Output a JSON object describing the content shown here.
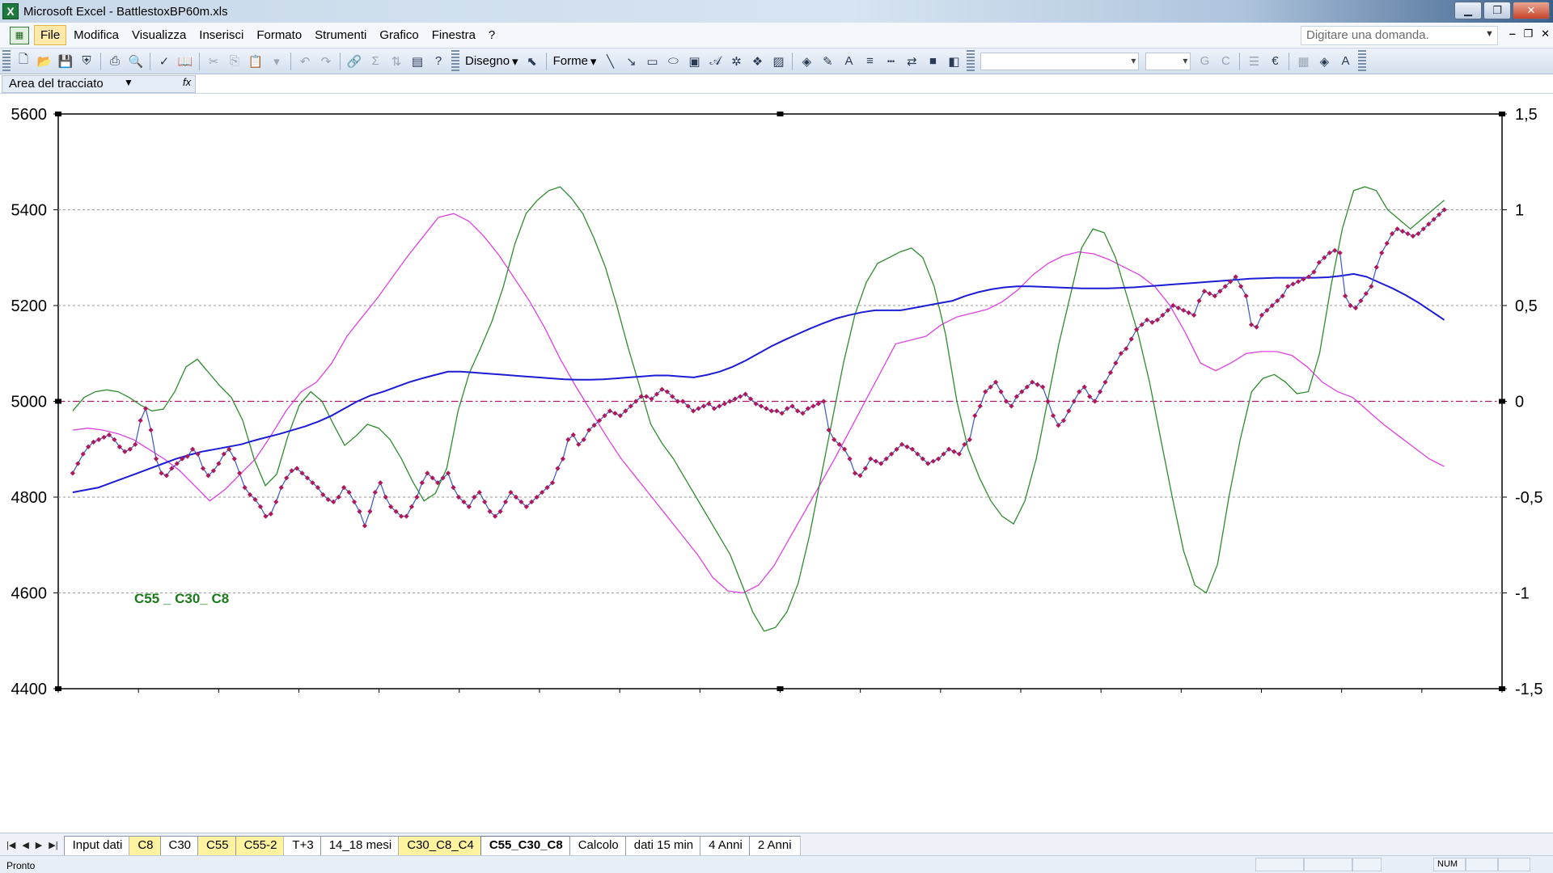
{
  "window": {
    "title": "Microsoft Excel - BattlestoxBP60m.xls",
    "min_glyph": "▁",
    "max_glyph": "❐",
    "close_glyph": "✕"
  },
  "menu": {
    "items": [
      "File",
      "Modifica",
      "Visualizza",
      "Inserisci",
      "Formato",
      "Strumenti",
      "Grafico",
      "Finestra",
      "?"
    ],
    "ask_placeholder": "Digitare una domanda.",
    "doc_buttons": [
      "‒",
      "❐",
      "✕"
    ]
  },
  "toolbar": {
    "draw_label": "Disegno",
    "shapes_label": "Forme",
    "bold": "G",
    "italic": "C",
    "euro": "€"
  },
  "objectbar": {
    "selected_object": "Area del tracciato",
    "fx": "fx"
  },
  "sheet_tabs": [
    {
      "label": "Input dati",
      "color": "white"
    },
    {
      "label": "C8",
      "color": "yellow"
    },
    {
      "label": "C30",
      "color": "white"
    },
    {
      "label": "C55",
      "color": "yellow"
    },
    {
      "label": "C55-2",
      "color": "yellow"
    },
    {
      "label": "T+3",
      "color": "white"
    },
    {
      "label": "14_18 mesi",
      "color": "white"
    },
    {
      "label": "C30_C8_C4",
      "color": "yellow"
    },
    {
      "label": "C55_C30_C8",
      "color": "active"
    },
    {
      "label": "Calcolo",
      "color": "white"
    },
    {
      "label": "dati 15 min",
      "color": "white"
    },
    {
      "label": "4 Anni",
      "color": "white"
    },
    {
      "label": "2 Anni",
      "color": "white"
    }
  ],
  "status": {
    "ready": "Pronto",
    "num": "NUM"
  },
  "chart_data": {
    "type": "line",
    "title": "",
    "annotation": "C55 _ C30_ C8",
    "annotation_color": "#1a7a1a",
    "y_left": {
      "min": 4400,
      "max": 5600,
      "ticks": [
        4400,
        4600,
        4800,
        5000,
        5200,
        5400,
        5600
      ]
    },
    "y_right": {
      "min": -1.5,
      "max": 1.5,
      "ticks": [
        "-1,5",
        "-1",
        "-0,5",
        "0",
        "0,5",
        "1",
        "1,5"
      ]
    },
    "x_points": 240,
    "grid": "horizontal dashed",
    "zero_line_color": "#b0186a",
    "colors": {
      "price_line": "#3a57c6",
      "price_marker": "#b0185a",
      "ma": "#1c1cd6",
      "green": "#2e8b2e",
      "magenta": "#e040e0"
    },
    "series": [
      {
        "axis": "left",
        "role": "price",
        "values": [
          4850,
          4870,
          4890,
          4905,
          4915,
          4920,
          4925,
          4930,
          4920,
          4905,
          4895,
          4900,
          4910,
          4960,
          4985,
          4940,
          4880,
          4850,
          4845,
          4860,
          4870,
          4880,
          4885,
          4900,
          4890,
          4860,
          4845,
          4855,
          4870,
          4890,
          4900,
          4880,
          4850,
          4820,
          4805,
          4795,
          4780,
          4760,
          4765,
          4790,
          4820,
          4840,
          4855,
          4860,
          4850,
          4840,
          4830,
          4820,
          4805,
          4795,
          4790,
          4800,
          4820,
          4810,
          4790,
          4770,
          4740,
          4770,
          4810,
          4830,
          4800,
          4780,
          4770,
          4760,
          4760,
          4780,
          4800,
          4830,
          4850,
          4840,
          4830,
          4840,
          4850,
          4820,
          4800,
          4790,
          4780,
          4800,
          4810,
          4790,
          4770,
          4760,
          4770,
          4790,
          4810,
          4800,
          4790,
          4780,
          4790,
          4800,
          4810,
          4820,
          4830,
          4860,
          4880,
          4920,
          4930,
          4910,
          4920,
          4940,
          4950,
          4960,
          4970,
          4980,
          4975,
          4970,
          4980,
          4990,
          5000,
          5010,
          5010,
          5005,
          5015,
          5025,
          5020,
          5010,
          5000,
          5000,
          4990,
          4980,
          4985,
          4990,
          4995,
          4985,
          4990,
          4995,
          5000,
          5005,
          5010,
          5015,
          5005,
          4995,
          4990,
          4985,
          4980,
          4980,
          4975,
          4985,
          4990,
          4980,
          4975,
          4985,
          4990,
          4995,
          5000,
          4940,
          4920,
          4910,
          4900,
          4880,
          4850,
          4845,
          4860,
          4880,
          4875,
          4870,
          4880,
          4890,
          4900,
          4910,
          4905,
          4900,
          4890,
          4880,
          4870,
          4875,
          4880,
          4890,
          4900,
          4895,
          4890,
          4910,
          4920,
          4970,
          4990,
          5020,
          5030,
          5040,
          5020,
          5000,
          4990,
          5010,
          5020,
          5030,
          5040,
          5035,
          5030,
          5000,
          4970,
          4950,
          4960,
          4980,
          5000,
          5020,
          5030,
          5010,
          5000,
          5020,
          5040,
          5060,
          5080,
          5100,
          5110,
          5130,
          5150,
          5160,
          5170,
          5165,
          5170,
          5180,
          5190,
          5200,
          5195,
          5190,
          5185,
          5180,
          5210,
          5230,
          5225,
          5220,
          5230,
          5240,
          5250,
          5260,
          5240,
          5220,
          5160,
          5155,
          5180,
          5190,
          5200,
          5210,
          5220,
          5240,
          5245,
          5250,
          5255,
          5260,
          5270,
          5290,
          5300,
          5310,
          5315,
          5310,
          5220,
          5200,
          5195,
          5210,
          5225,
          5240,
          5280,
          5310,
          5330,
          5350,
          5360,
          5355,
          5350,
          5345,
          5350,
          5360,
          5370,
          5380,
          5390,
          5400
        ],
        "source": "read"
      },
      {
        "axis": "left",
        "role": "moving_average",
        "values": [
          4810,
          4815,
          4820,
          4830,
          4840,
          4850,
          4860,
          4870,
          4880,
          4888,
          4895,
          4900,
          4905,
          4910,
          4918,
          4925,
          4932,
          4940,
          4948,
          4958,
          4970,
          4985,
          5000,
          5012,
          5020,
          5030,
          5040,
          5048,
          5055,
          5062,
          5062,
          5060,
          5058,
          5056,
          5054,
          5052,
          5050,
          5048,
          5046,
          5045,
          5045,
          5046,
          5048,
          5050,
          5052,
          5054,
          5054,
          5052,
          5050,
          5055,
          5062,
          5072,
          5085,
          5100,
          5115,
          5128,
          5140,
          5152,
          5163,
          5173,
          5180,
          5186,
          5190,
          5190,
          5190,
          5195,
          5200,
          5205,
          5210,
          5220,
          5228,
          5234,
          5238,
          5240,
          5240,
          5239,
          5238,
          5237,
          5236,
          5236,
          5236,
          5237,
          5238,
          5240,
          5242,
          5244,
          5246,
          5248,
          5250,
          5252,
          5254,
          5256,
          5257,
          5258,
          5258,
          5258,
          5258,
          5259,
          5262,
          5266,
          5260,
          5248,
          5236,
          5222,
          5206,
          5188,
          5170
        ],
        "source": "read"
      },
      {
        "axis": "right",
        "role": "oscillator_green",
        "values": [
          -0.05,
          0.02,
          0.05,
          0.06,
          0.05,
          0.02,
          -0.02,
          -0.05,
          -0.04,
          0.05,
          0.18,
          0.22,
          0.15,
          0.08,
          0.02,
          -0.1,
          -0.3,
          -0.44,
          -0.38,
          -0.18,
          -0.02,
          0.05,
          0.0,
          -0.12,
          -0.23,
          -0.18,
          -0.12,
          -0.14,
          -0.2,
          -0.3,
          -0.42,
          -0.52,
          -0.48,
          -0.35,
          -0.05,
          0.15,
          0.28,
          0.42,
          0.6,
          0.82,
          0.98,
          1.05,
          1.1,
          1.12,
          1.06,
          0.98,
          0.85,
          0.7,
          0.5,
          0.28,
          0.08,
          -0.12,
          -0.22,
          -0.3,
          -0.4,
          -0.5,
          -0.6,
          -0.7,
          -0.8,
          -0.95,
          -1.1,
          -1.2,
          -1.18,
          -1.1,
          -0.95,
          -0.7,
          -0.4,
          -0.1,
          0.2,
          0.45,
          0.62,
          0.72,
          0.75,
          0.78,
          0.8,
          0.75,
          0.6,
          0.35,
          0.0,
          -0.25,
          -0.4,
          -0.52,
          -0.6,
          -0.64,
          -0.52,
          -0.3,
          0.0,
          0.3,
          0.55,
          0.8,
          0.9,
          0.88,
          0.75,
          0.55,
          0.35,
          0.1,
          -0.2,
          -0.5,
          -0.78,
          -0.96,
          -1.0,
          -0.85,
          -0.5,
          -0.2,
          0.05,
          0.12,
          0.14,
          0.1,
          0.04,
          0.05,
          0.25,
          0.6,
          0.9,
          1.1,
          1.12,
          1.1,
          1.0,
          0.95,
          0.9,
          0.95,
          1.0,
          1.05
        ],
        "source": "read"
      },
      {
        "axis": "right",
        "role": "oscillator_magenta",
        "values": [
          -0.15,
          -0.14,
          -0.15,
          -0.17,
          -0.2,
          -0.25,
          -0.3,
          -0.36,
          -0.44,
          -0.52,
          -0.46,
          -0.38,
          -0.3,
          -0.18,
          -0.05,
          0.05,
          0.1,
          0.2,
          0.34,
          0.44,
          0.54,
          0.65,
          0.76,
          0.86,
          0.96,
          0.98,
          0.94,
          0.86,
          0.76,
          0.64,
          0.52,
          0.38,
          0.22,
          0.08,
          -0.05,
          -0.18,
          -0.3,
          -0.4,
          -0.5,
          -0.6,
          -0.7,
          -0.8,
          -0.92,
          -0.99,
          -1.0,
          -0.96,
          -0.86,
          -0.72,
          -0.58,
          -0.44,
          -0.3,
          -0.15,
          0.0,
          0.15,
          0.3,
          0.32,
          0.34,
          0.4,
          0.44,
          0.46,
          0.48,
          0.52,
          0.58,
          0.66,
          0.72,
          0.76,
          0.78,
          0.77,
          0.74,
          0.7,
          0.66,
          0.6,
          0.5,
          0.36,
          0.2,
          0.16,
          0.2,
          0.25,
          0.26,
          0.26,
          0.24,
          0.18,
          0.1,
          0.05,
          0.02,
          -0.05,
          -0.12,
          -0.18,
          -0.24,
          -0.3,
          -0.34
        ]
      }
    ]
  }
}
